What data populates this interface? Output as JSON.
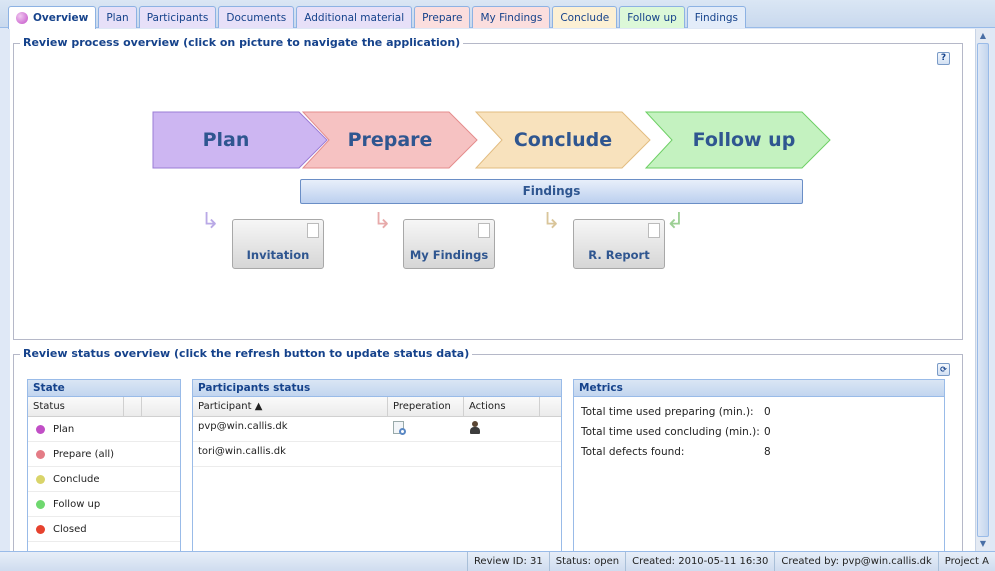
{
  "tabs": [
    {
      "label": "Overview",
      "bg": "#ffffff"
    },
    {
      "label": "Plan",
      "bg": "#e7e0f8"
    },
    {
      "label": "Participants",
      "bg": "#e7e0f8"
    },
    {
      "label": "Documents",
      "bg": "#e7e0f8"
    },
    {
      "label": "Additional material",
      "bg": "#e7e0f8"
    },
    {
      "label": "Prepare",
      "bg": "#fbdede"
    },
    {
      "label": "My Findings",
      "bg": "#fbdede"
    },
    {
      "label": "Conclude",
      "bg": "#fcf0d4"
    },
    {
      "label": "Follow up",
      "bg": "#dcf8d8"
    },
    {
      "label": "Findings",
      "bg": "#e3ecf9"
    }
  ],
  "process": {
    "legend": "Review process overview (click on picture to navigate the application)",
    "help": "?",
    "steps": [
      {
        "label": "Plan",
        "color": "#cdb6f2",
        "dark": "#9a7cd6"
      },
      {
        "label": "Prepare",
        "color": "#f6c2c2",
        "dark": "#e48c8c"
      },
      {
        "label": "Conclude",
        "color": "#f8e2bd",
        "dark": "#e2bc80"
      },
      {
        "label": "Follow up",
        "color": "#c4f2c0",
        "dark": "#6dcf64"
      }
    ],
    "findings": "Findings",
    "docs": [
      "Invitation",
      "My Findings",
      "R. Report"
    ]
  },
  "status": {
    "legend": "Review status overview (click the refresh button to update status data)",
    "refresh_icon": "refresh-icon",
    "state": {
      "title": "State",
      "column": "Status",
      "rows": [
        {
          "label": "Plan",
          "color": "#c14fc6"
        },
        {
          "label": "Prepare (all)",
          "color": "#e47c86"
        },
        {
          "label": "Conclude",
          "color": "#d9d46a"
        },
        {
          "label": "Follow up",
          "color": "#6fd86f"
        },
        {
          "label": "Closed",
          "color": "#e6422e"
        }
      ]
    },
    "participants": {
      "title": "Participants status",
      "columns": [
        "Participant ▲",
        "Preperation",
        "Actions"
      ],
      "rows": [
        {
          "email": "pvp@win.callis.dk",
          "prep_icon": "document-search-icon",
          "action_icon": "user-icon"
        },
        {
          "email": "tori@win.callis.dk"
        }
      ]
    },
    "metrics": {
      "title": "Metrics",
      "rows": [
        {
          "label": "Total time used preparing (min.):",
          "value": "0"
        },
        {
          "label": "Total time used concluding (min.):",
          "value": "0"
        },
        {
          "label": "Total defects found:",
          "value": "8"
        }
      ]
    }
  },
  "statusbar": {
    "review_id": "Review ID: 31",
    "status": "Status: open",
    "created": "Created: 2010-05-11 16:30",
    "created_by": "Created by: pvp@win.callis.dk",
    "project": "Project A"
  }
}
